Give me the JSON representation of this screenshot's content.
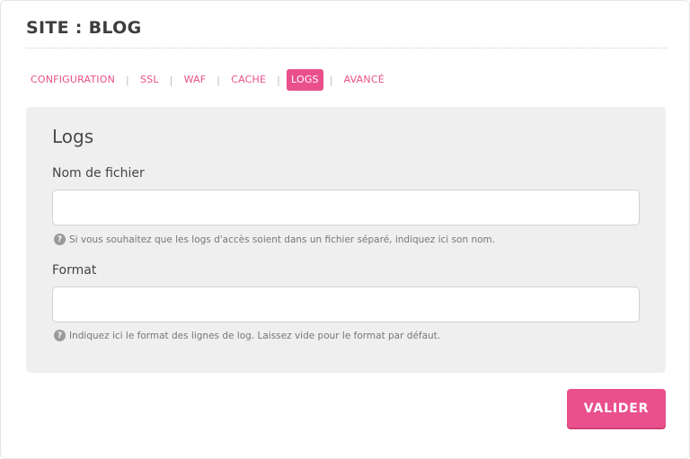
{
  "header": {
    "title": "SITE : BLOG"
  },
  "tabs": [
    {
      "label": "CONFIGURATION",
      "active": false
    },
    {
      "label": "SSL",
      "active": false
    },
    {
      "label": "WAF",
      "active": false
    },
    {
      "label": "CACHE",
      "active": false
    },
    {
      "label": "LOGS",
      "active": true
    },
    {
      "label": "AVANCÉ",
      "active": false
    }
  ],
  "tab_separator": "|",
  "panel": {
    "title": "Logs",
    "filename": {
      "label": "Nom de fichier",
      "value": "",
      "help": "Si vous souhaitez que les logs d'accès soient dans un fichier séparé, indiquez ici son nom."
    },
    "format": {
      "label": "Format",
      "value": "",
      "help": "Indiquez ici le format des lignes de log. Laissez vide pour le format par défaut."
    },
    "help_icon_glyph": "?"
  },
  "actions": {
    "submit_label": "VALIDER"
  },
  "colors": {
    "accent": "#e9508c",
    "panel_bg": "#efefef",
    "title_text": "#3d3d3d"
  },
  "icons": {
    "help": "question-circle-icon"
  }
}
